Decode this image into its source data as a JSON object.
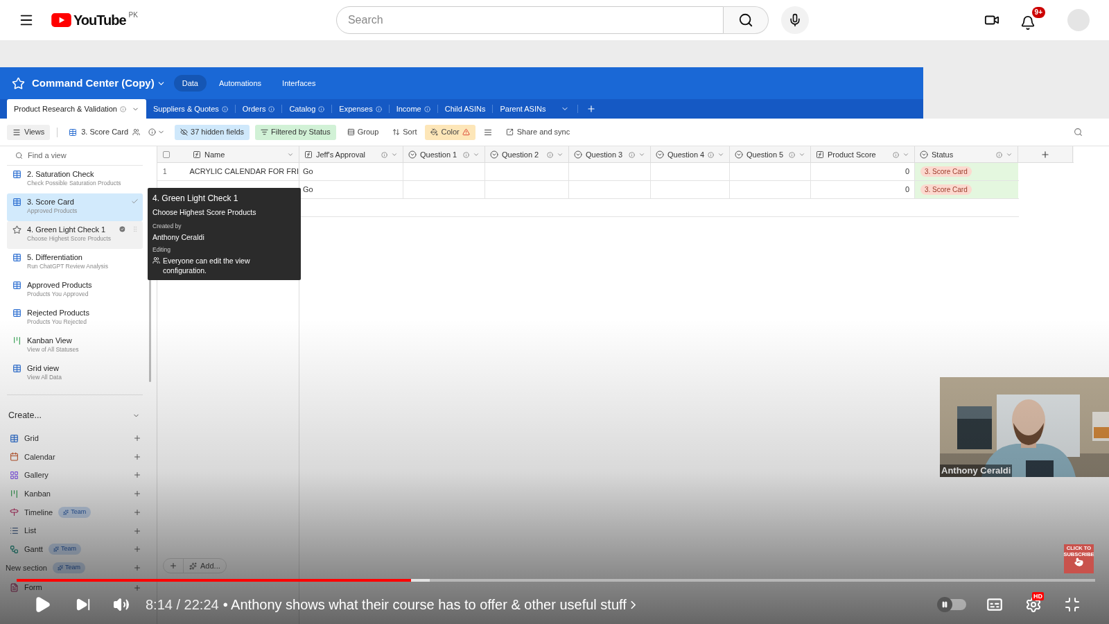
{
  "youtube": {
    "logo": "YouTube",
    "region": "PK",
    "search": {
      "placeholder": "Search"
    },
    "notifications": "9+"
  },
  "app": {
    "base_title": "Command Center (Copy)",
    "nav": [
      {
        "label": "Data",
        "selected": true
      },
      {
        "label": "Automations",
        "selected": false
      },
      {
        "label": "Interfaces",
        "selected": false
      }
    ],
    "tables": [
      {
        "label": "Product Research & Validation",
        "selected": true,
        "info": true
      },
      {
        "label": "Suppliers & Quotes",
        "selected": false,
        "info": true
      },
      {
        "label": "Orders",
        "selected": false,
        "info": true
      },
      {
        "label": "Catalog",
        "selected": false,
        "info": true
      },
      {
        "label": "Expenses",
        "selected": false,
        "info": true
      },
      {
        "label": "Income",
        "selected": false,
        "info": true
      },
      {
        "label": "Child ASINs",
        "selected": false,
        "info": false
      },
      {
        "label": "Parent ASINs",
        "selected": false,
        "info": false
      }
    ],
    "toolbar": {
      "views": "Views",
      "current_view": "3. Score Card",
      "hidden_fields": "37 hidden fields",
      "filter": "Filtered by Status",
      "group": "Group",
      "sort": "Sort",
      "color_button": "Color",
      "share": "Share and sync"
    },
    "sidebar": {
      "search": {
        "placeholder": "Find a view"
      },
      "views": [
        {
          "kind": "grid",
          "title": "2. Saturation Check",
          "subtitle": "Check Possible Saturation Products",
          "selected": false,
          "hovered": false
        },
        {
          "kind": "grid",
          "title": "3. Score Card",
          "subtitle": "Approved Products",
          "selected": true,
          "hovered": false
        },
        {
          "kind": "grid",
          "title": "4. Green Light Check 1",
          "subtitle": "Choose Highest Score Products",
          "selected": false,
          "hovered": true
        },
        {
          "kind": "grid",
          "title": "5. Differentiation",
          "subtitle": "Run ChatGPT Review Analysis",
          "selected": false,
          "hovered": false
        },
        {
          "kind": "grid",
          "title": "Approved Products",
          "subtitle": "Products You Approved",
          "selected": false,
          "hovered": false
        },
        {
          "kind": "grid",
          "title": "Rejected Products",
          "subtitle": "Products You Rejected",
          "selected": false,
          "hovered": false
        },
        {
          "kind": "kanban",
          "title": "Kanban View",
          "subtitle": "View of All Statuses",
          "selected": false,
          "hovered": false
        },
        {
          "kind": "grid",
          "title": "Grid view",
          "subtitle": "View All Data",
          "selected": false,
          "hovered": false
        }
      ],
      "create_title": "Create...",
      "create": [
        {
          "kind": "grid",
          "label": "Grid"
        },
        {
          "kind": "calendar",
          "label": "Calendar"
        },
        {
          "kind": "gallery",
          "label": "Gallery"
        },
        {
          "kind": "kanban",
          "label": "Kanban"
        },
        {
          "kind": "timeline",
          "label": "Timeline",
          "badge": "Team"
        },
        {
          "kind": "list",
          "label": "List"
        },
        {
          "kind": "gantt",
          "label": "Gantt",
          "badge": "Team"
        },
        {
          "kind": "section",
          "label": "New section",
          "badge": "Team"
        },
        {
          "kind": "form",
          "label": "Form"
        }
      ]
    },
    "grid": {
      "header_checkbox": {
        "checked": false
      },
      "columns": [
        {
          "kind": "formula",
          "name": "Name",
          "info": false
        },
        {
          "kind": "formula",
          "name": "Jeff's Approval",
          "info": true
        },
        {
          "kind": "select",
          "name": "Question 1",
          "info": true
        },
        {
          "kind": "select",
          "name": "Question 2",
          "info": true
        },
        {
          "kind": "select",
          "name": "Question 3",
          "info": true
        },
        {
          "kind": "select",
          "name": "Question 4",
          "info": true
        },
        {
          "kind": "select",
          "name": "Question 5",
          "info": true
        },
        {
          "kind": "formula",
          "name": "Product Score",
          "info": true
        },
        {
          "kind": "select",
          "name": "Status",
          "info": true
        }
      ],
      "rows": [
        {
          "number": "1",
          "name": "ACRYLIC CALENDAR FOR FRI",
          "approval": "Go",
          "score": "0",
          "status": "3. Score Card"
        },
        {
          "approval": "Go",
          "score": "0",
          "status": "3. Score Card"
        }
      ],
      "add_button": "Add..."
    },
    "tooltip": {
      "title": "4. Green Light Check 1",
      "description": "Choose Highest Score Products",
      "created_label": "Created by",
      "creator": "Anthony Ceraldi",
      "editing_label": "Editing",
      "editing": "Everyone can edit the view configuration."
    }
  },
  "webcam": {
    "caption": "Anthony Ceraldi"
  },
  "subscribe": "CLICK TO SUBSCRIBE",
  "player": {
    "progress": {
      "level": 0.366
    },
    "buffered": {
      "level": 0.383
    },
    "time": "8:14 / 22:24",
    "chapter": "• Anthony shows what their course has to offer & other useful stuff",
    "autoplay_on": false,
    "quality_badge": "HD"
  }
}
